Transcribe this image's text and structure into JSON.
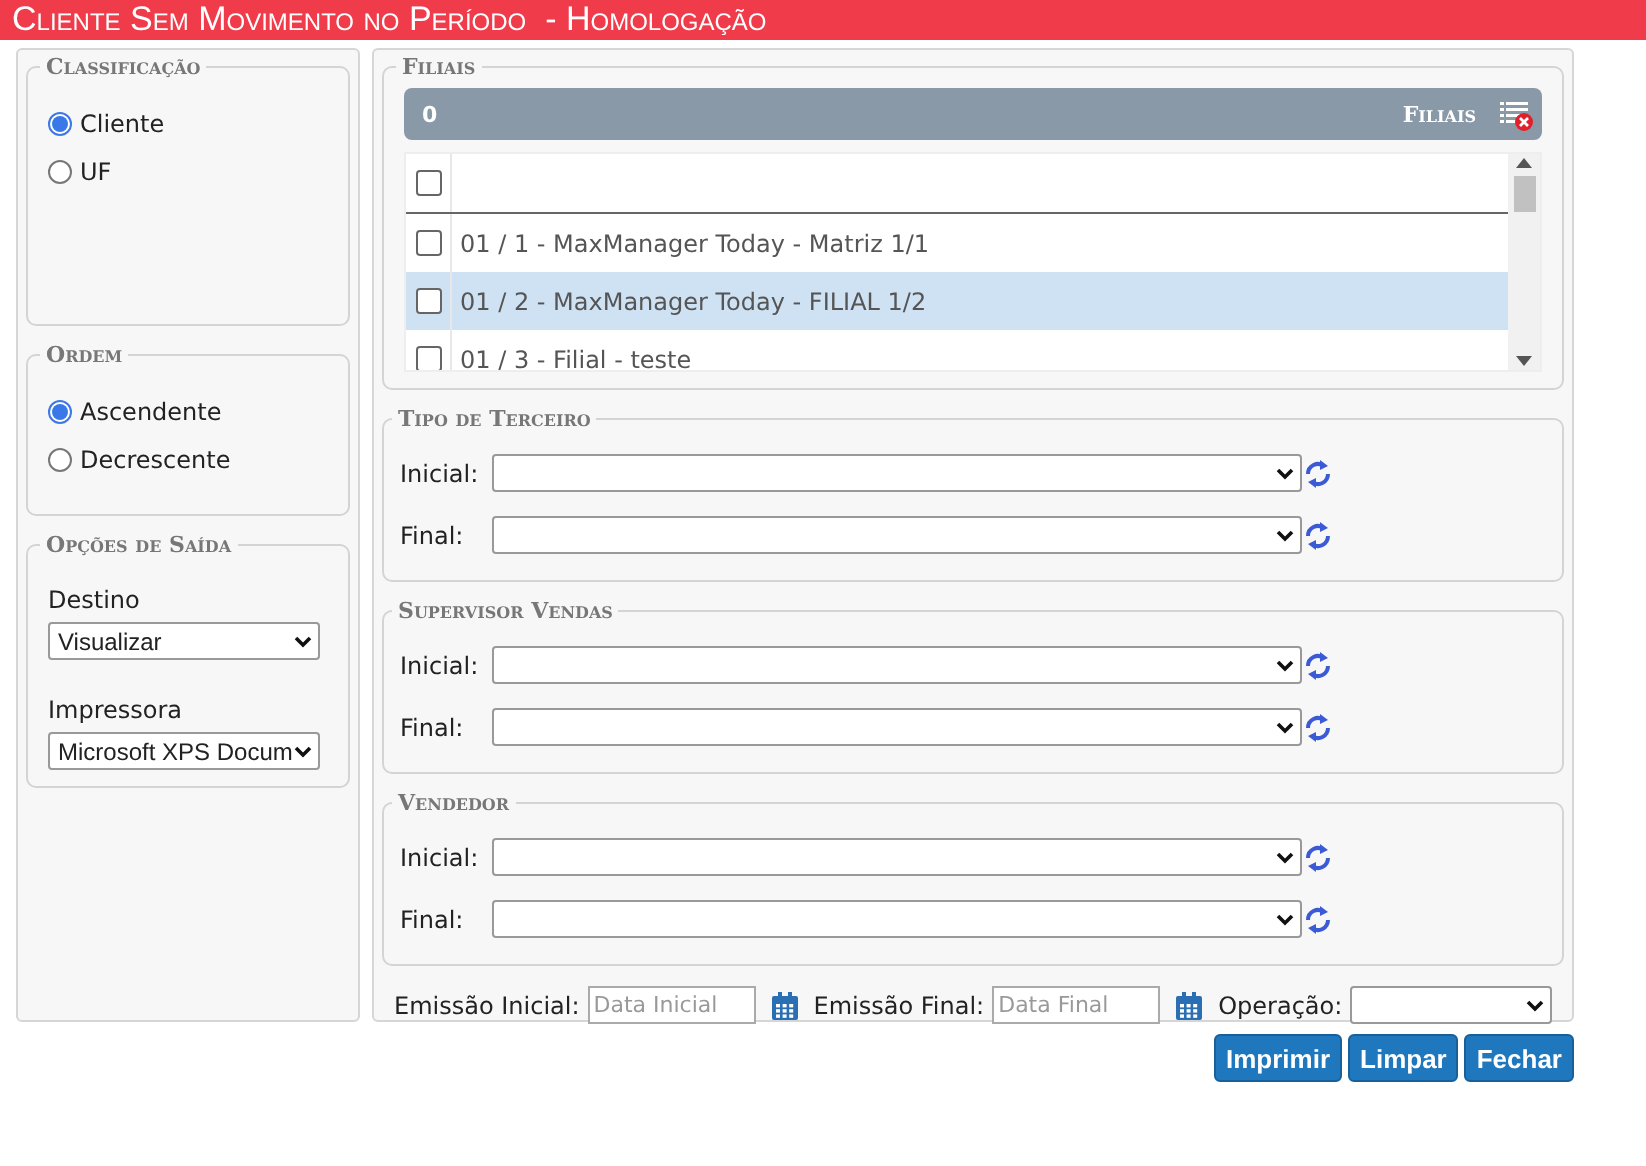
{
  "title": "Cliente Sem Movimento no Período  - Homologação",
  "classificacao": {
    "legend": "Classificação",
    "options": [
      {
        "label": "Cliente",
        "selected": true
      },
      {
        "label": "UF",
        "selected": false
      }
    ]
  },
  "ordem": {
    "legend": "Ordem",
    "options": [
      {
        "label": "Ascendente",
        "selected": true
      },
      {
        "label": "Decrescente",
        "selected": false
      }
    ]
  },
  "saida": {
    "legend": "Opções de Saída",
    "destino": {
      "label": "Destino",
      "value": "Visualizar"
    },
    "impressora": {
      "label": "Impressora",
      "value": "Microsoft XPS Docum"
    }
  },
  "filiais": {
    "legend": "Filiais",
    "count": "0",
    "header": "Filiais",
    "select_all_checked": false,
    "rows": [
      {
        "label": "01 / 1 - MaxManager Today - Matriz 1/1",
        "checked": false,
        "selected": false
      },
      {
        "label": "01 / 2 - MaxManager Today - FILIAL 1/2",
        "checked": false,
        "selected": true
      },
      {
        "label": "01 / 3 - Filial - teste",
        "checked": false,
        "selected": false
      }
    ]
  },
  "ranges": [
    {
      "legend": "Tipo de Terceiro",
      "fields": [
        {
          "label": "Inicial:"
        },
        {
          "label": "Final:"
        }
      ]
    },
    {
      "legend": "Supervisor Vendas",
      "fields": [
        {
          "label": "Inicial:"
        },
        {
          "label": "Final:"
        }
      ]
    },
    {
      "legend": "Vendedor",
      "fields": [
        {
          "label": "Inicial:"
        },
        {
          "label": "Final:"
        }
      ]
    }
  ],
  "emissao_inicial": {
    "label": "Emissão Inicial:",
    "placeholder": "Data Inicial"
  },
  "emissao_final": {
    "label": "Emissão Final:",
    "placeholder": "Data Final"
  },
  "operacao": {
    "label": "Operação:"
  },
  "buttons": [
    "Imprimir",
    "Limpar",
    "Fechar"
  ]
}
